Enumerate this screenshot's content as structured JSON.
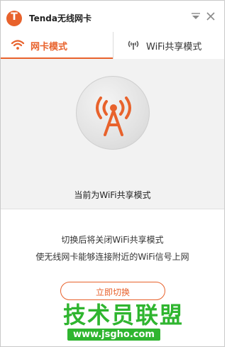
{
  "window": {
    "title": "Tenda无线网卡",
    "logo_letter": "T"
  },
  "tabs": [
    {
      "label": "网卡模式",
      "active": true,
      "icon": "wifi-icon"
    },
    {
      "label": "WiFi共享模式",
      "active": false,
      "icon": "antenna-icon"
    }
  ],
  "status": {
    "icon": "broadcast-tower-icon",
    "text": "当前为WiFi共享模式"
  },
  "description": {
    "line1": "切换后将关闭WiFi共享模式",
    "line2": "使无线网卡能够连接附近的WiFi信号上网"
  },
  "action": {
    "switch_label": "立即切换"
  },
  "watermark": {
    "text": "技术员联盟",
    "url": "www.jsgho.com"
  },
  "colors": {
    "accent": "#e8622c",
    "watermark_green": "#2fb52f",
    "panel_bg": "#f2f2f2"
  }
}
